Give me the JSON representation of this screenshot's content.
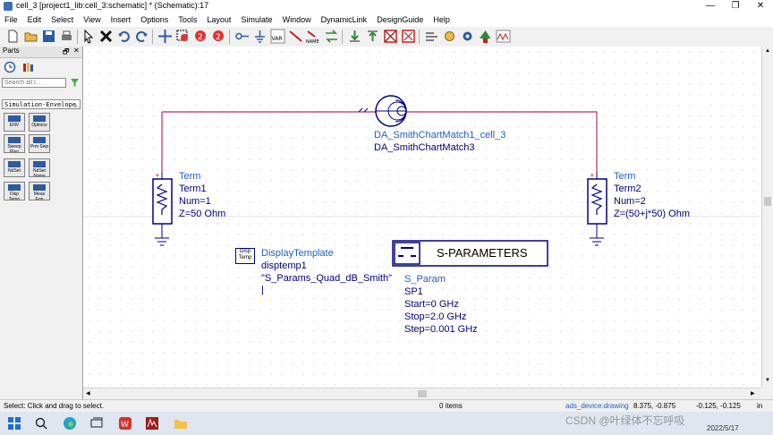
{
  "window": {
    "title": "cell_3 [project1_lib:cell_3:schematic] * (Schematic):17",
    "controls": [
      "—",
      "❐",
      "✕"
    ]
  },
  "menu": [
    "File",
    "Edit",
    "Select",
    "View",
    "Insert",
    "Options",
    "Tools",
    "Layout",
    "Simulate",
    "Window",
    "DynamicLink",
    "DesignGuide",
    "Help"
  ],
  "parts": {
    "title": "Parts",
    "header_controls": [
      "🗗",
      "✕"
    ],
    "search_placeholder": "Search all l...",
    "palette": "Simulation-Envelope",
    "buttons": [
      {
        "label": "ENV"
      },
      {
        "label": "Options"
      },
      {
        "label": "Sweep Plan"
      },
      {
        "label": "Prm Swp"
      },
      {
        "label": "NdSet"
      },
      {
        "label": "NdSet Name"
      },
      {
        "label": "Disp Temp"
      },
      {
        "label": "Meas Eqn"
      }
    ]
  },
  "schematic": {
    "smith_match": {
      "type": "DA_SmithChartMatch1_cell_3",
      "name": "DA_SmithChartMatch3"
    },
    "term1": {
      "type": "Term",
      "name": "Term1",
      "num": "Num=1",
      "z": "Z=50 Ohm"
    },
    "term2": {
      "type": "Term",
      "name": "Term2",
      "num": "Num=2",
      "z": "Z=(50+j*50) Ohm"
    },
    "display_template": {
      "icon_label": "Disp Temp",
      "type": "DisplayTemplate",
      "name": "disptemp1",
      "value": "\"S_Params_Quad_dB_Smith\"",
      "cursor": "|"
    },
    "sparam": {
      "banner": "S-PARAMETERS",
      "type": "S_Param",
      "name": "SP1",
      "start": "Start=0 GHz",
      "stop": "Stop=2.0 GHz",
      "step": "Step=0.001 GHz"
    }
  },
  "status": {
    "message": "Select: Click and drag to select.",
    "items": "0 items",
    "layer": "ads_device:drawing",
    "coord1": "8.375, -0.875",
    "coord2": "-0.125, -0.125",
    "zoom": "in"
  },
  "taskbar": {
    "watermark": "CSDN @叶绿体不忘呼吸",
    "date": "2022/5/17"
  },
  "colors": {
    "wire": "#b0306a",
    "text_blue": "#1f5fc8",
    "component": "#000080"
  }
}
